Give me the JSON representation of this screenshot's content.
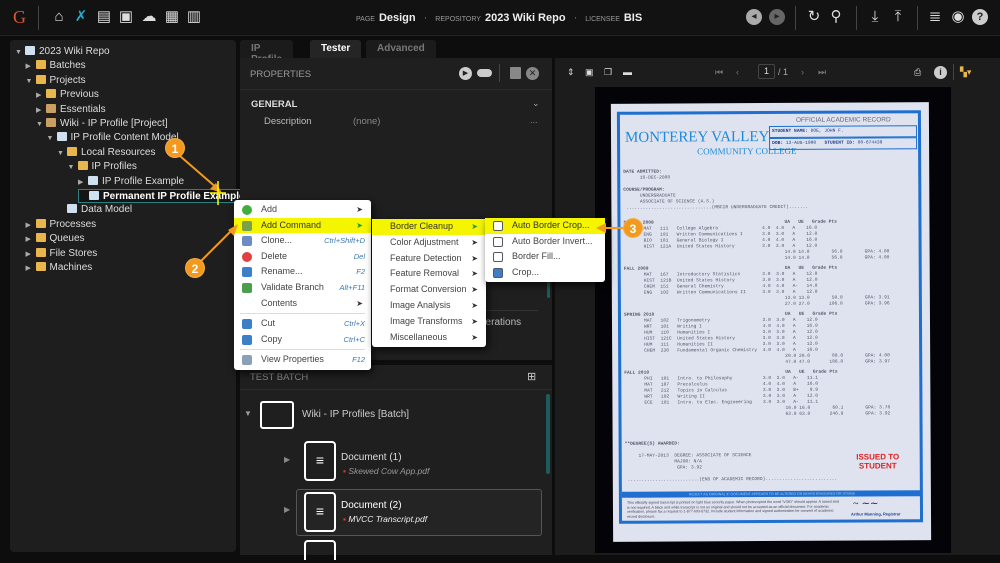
{
  "topbar": {
    "logo": "G",
    "nav_icons": [
      "home-icon",
      "tools-icon",
      "archive-icon",
      "run-icon",
      "cloud-upload-icon",
      "briefcase-clock-icon",
      "bar-chart-icon"
    ],
    "page_label": "PAGE",
    "page_value": "Design",
    "repository_label": "REPOSITORY",
    "repository_value": "2023 Wiki Repo",
    "licensee_label": "LICENSEE",
    "licensee_value": "BIS",
    "right_icons": [
      "back-icon",
      "forward-icon",
      "refresh-icon",
      "search-icon",
      "download-icon",
      "upload-icon",
      "database-icon",
      "user-icon",
      "help-icon"
    ]
  },
  "tree": [
    {
      "label": "2023 Wiki Repo",
      "level": 0,
      "expanded": true,
      "icon": "repo"
    },
    {
      "label": "Batches",
      "level": 1,
      "expanded": false,
      "icon": "folder"
    },
    {
      "label": "Projects",
      "level": 1,
      "expanded": true,
      "icon": "folder"
    },
    {
      "label": "Previous",
      "level": 2,
      "expanded": false,
      "icon": "folder"
    },
    {
      "label": "Essentials",
      "level": 2,
      "expanded": false,
      "icon": "box"
    },
    {
      "label": "Wiki - IP Profile [Project]",
      "level": 2,
      "expanded": true,
      "icon": "box"
    },
    {
      "label": "IP Profile Content Model",
      "level": 3,
      "expanded": true,
      "icon": "model"
    },
    {
      "label": "Local Resources",
      "level": 4,
      "expanded": true,
      "icon": "folder"
    },
    {
      "label": "IP Profiles",
      "level": 5,
      "expanded": true,
      "icon": "folder"
    },
    {
      "label": "IP Profile Example",
      "level": 6,
      "expanded": false,
      "icon": "profile"
    },
    {
      "label": "Permanent IP Profile Example",
      "level": 6,
      "selected": true,
      "icon": "profile"
    },
    {
      "label": "Data Model",
      "level": 4,
      "icon": "data"
    },
    {
      "label": "Processes",
      "level": 1,
      "expanded": false,
      "icon": "folder"
    },
    {
      "label": "Queues",
      "level": 1,
      "expanded": false,
      "icon": "folder"
    },
    {
      "label": "File Stores",
      "level": 1,
      "expanded": false,
      "icon": "folder"
    },
    {
      "label": "Machines",
      "level": 1,
      "expanded": false,
      "icon": "folder"
    }
  ],
  "tabs": [
    {
      "label": "IP Profile"
    },
    {
      "label": "Tester",
      "active": true
    },
    {
      "label": "Advanced"
    }
  ],
  "properties": {
    "title": "PROPERTIES",
    "section": "GENERAL",
    "rows": [
      {
        "label": "Description",
        "value": "(none)",
        "more": "..."
      }
    ],
    "hidden_text": "perations"
  },
  "test_batch": {
    "title": "TEST BATCH",
    "root": "Wiki - IP Profiles [Batch]",
    "documents": [
      {
        "name": "Document (1)",
        "file": "Skewed Cow App.pdf"
      },
      {
        "name": "Document (2)",
        "file": "MVCC Transcript.pdf",
        "selected": true
      }
    ]
  },
  "viewer": {
    "page_current": "1",
    "page_total": "/ 1"
  },
  "context_menu": [
    {
      "label": "Add",
      "submenu": true,
      "icon": "plus-circle-icon"
    },
    {
      "label": "Add Command",
      "submenu": true,
      "highlighted": true,
      "icon": "command-icon"
    },
    {
      "label": "Clone...",
      "shortcut": "Ctrl+Shift+D",
      "icon": "clone-icon"
    },
    {
      "label": "Delete",
      "shortcut": "Del",
      "icon": "delete-icon"
    },
    {
      "label": "Rename...",
      "shortcut": "F2",
      "icon": "rename-icon"
    },
    {
      "label": "Validate Branch",
      "shortcut": "Alt+F11",
      "icon": "check-icon"
    },
    {
      "label": "Contents",
      "submenu": true
    },
    {
      "label": "Cut",
      "shortcut": "Ctrl+X",
      "icon": "scissors-icon",
      "sep_before": true
    },
    {
      "label": "Copy",
      "shortcut": "Ctrl+C",
      "icon": "copy-icon"
    },
    {
      "label": "View Properties",
      "shortcut": "F12",
      "icon": "properties-icon",
      "sep_before": true
    }
  ],
  "command_menu": [
    {
      "label": "Border Cleanup",
      "highlighted": true
    },
    {
      "label": "Color Adjustment"
    },
    {
      "label": "Feature Detection"
    },
    {
      "label": "Feature Removal"
    },
    {
      "label": "Format Conversion"
    },
    {
      "label": "Image Analysis"
    },
    {
      "label": "Image Transforms"
    },
    {
      "label": "Miscellaneous"
    }
  ],
  "border_menu": [
    {
      "label": "Auto Border Crop...",
      "highlighted": true
    },
    {
      "label": "Auto Border Invert..."
    },
    {
      "label": "Border Fill..."
    },
    {
      "label": "Crop..."
    }
  ],
  "callouts": [
    "1",
    "2",
    "3"
  ],
  "colors": {
    "highlight": "#f5f500",
    "callout": "#f39a1e",
    "accent": "#2aa8c8",
    "doc_blue": "#1e6fd0",
    "stamp": "#e02020"
  },
  "document": {
    "college_line1": "MONTEREY VALLEY",
    "college_line2": "COMMUNITY COLLEGE",
    "record_title": "OFFICIAL ACADEMIC RECORD",
    "student_name_label": "STUDENT NAME:",
    "student_name": "DOE, JOHN F.",
    "dob_label": "DOB:",
    "dob": "13-AUG-1980",
    "student_id_label": "STUDENT ID:",
    "student_id": "08-674439",
    "date_admitted_label": "DATE ADMITTED:",
    "date_admitted": "16-DEC-2008",
    "course_label": "COURSE/PROGRAM:",
    "course": "UNDERGRADUATE",
    "program": "ASSOCIATE OF SCIENCE (A.S.)",
    "credit_header": "(MBCIR UNDERGRADUATE CREDIT)",
    "terms": [
      {
        "term": "SPRING 2009",
        "rows": [
          "MAT   111   College Algebra                4.0  4.0   A    16.0",
          "ENG   101   Written Communications I       3.0  3.0   A    12.0",
          "BIO   181   General Biology I              4.0  4.0   A    16.0",
          "HIST  121A  United States History          3.0  3.0   A    12.0"
        ],
        "term_totals": "14.0 14.0        56.0        GPA: 4.00",
        "cum_totals": "14.0 14.0        56.0        GPA: 4.00"
      },
      {
        "term": "FALL 2009",
        "rows": [
          "MAT   167   Introductory Statistics        3.0  3.0   A    12.0",
          "HIST  121B  United States History          3.0  3.0   A    12.0",
          "CHEM  151   General Chemistry              4.0  4.0   A-   14.8",
          "ENG   102   Written Communications II      3.0  3.0   A    12.0"
        ],
        "term_totals": "13.0 13.0        50.8        GPA: 3.91",
        "cum_totals": "27.0 27.0       106.8        GPA: 3.96"
      },
      {
        "term": "SPRING 2010",
        "rows": [
          "MAT   182   Trigonometry                   3.0  3.0   A    12.0",
          "WRT   101   Writing I                      4.0  4.0   A    16.0",
          "HUM   110   Humanities I                   3.0  3.0   A    12.0",
          "HIST  121C  United States History          3.0  3.0   A    12.0",
          "HUM   111   Humanities II                  3.0  3.0   A    12.0",
          "CHEM  230   Fundamental Organic Chemistry  4.0  4.0   A    16.0"
        ],
        "term_totals": "20.0 20.0        80.0        GPA: 4.00",
        "cum_totals": "47.0 47.0       186.8        GPA: 3.97"
      },
      {
        "term": "FALL 2010",
        "rows": [
          "PHI   101   Intro. to Philosophy           3.0  3.0   A-   11.1",
          "MAT   187   Precalculus                    4.0  4.0   A    16.0",
          "MAT   212   Topics in Calculus             3.0  3.0   B+    9.9",
          "WRT   102   Writing II                     3.0  3.0   A    12.0",
          "ECE   101   Intro. to Elec. Engineering    3.0  3.0   A-   11.1"
        ],
        "term_totals": "16.0 16.0        60.1        GPA: 3.76",
        "cum_totals": "63.0 63.0       246.9        GPA: 3.92"
      }
    ],
    "col_header": "UA   UE   Grade Pts",
    "degree_label": "**DEGREE(S) AWARDED:",
    "degree_date": "17-MAY-2013",
    "degree": "DEGREE: ASSOCIATE OF SCIENCE",
    "major": "MAJOR: N/A",
    "gpa": "GPA: 3.92",
    "end": "(END OF ACADEMIC RECORD)",
    "stamp": "ISSUED TO STUDENT",
    "banner": "REJECT AS ORIGINAL IF DOCUMENT APPEARS TO BE ALTERED OR BEARS ERASURES OR STAINS",
    "footer": "This officially signed transcript is printed on light blue security paper. When photocopied the word \"VOID\" should appear. A raised seal is not required. A black and white transcript is not an original and should not be accepted as an official document. For academic verification, please fax a request to 1-877-693-0732. Include student information and signed authorization for consent of academic record disclosure.",
    "registrar": "Arthur Manning, Registrar"
  }
}
